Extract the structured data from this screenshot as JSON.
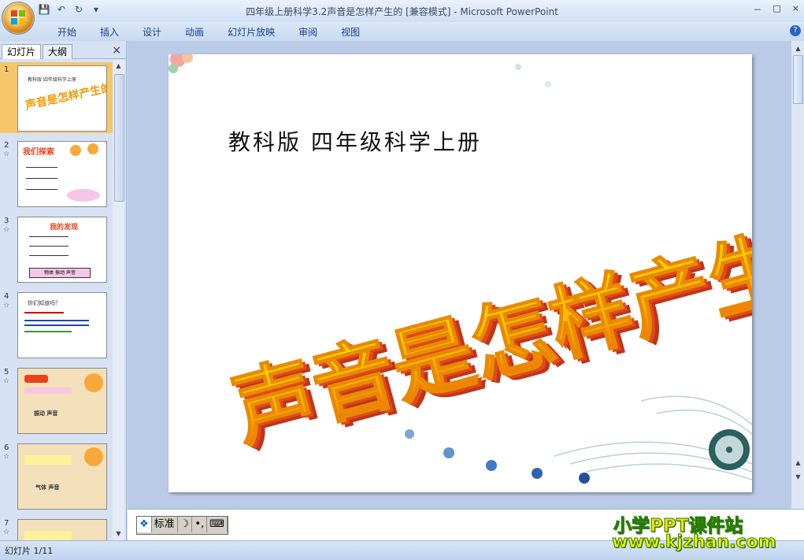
{
  "window": {
    "title": "四年级上册科学3.2声音是怎样产生的 [兼容模式] - Microsoft PowerPoint",
    "controls": [
      "－",
      "□",
      "×"
    ]
  },
  "qat": {
    "icons": [
      "save-icon",
      "undo-icon",
      "redo-icon",
      "customize-icon"
    ]
  },
  "ribbon": {
    "tabs": [
      "开始",
      "插入",
      "设计",
      "动画",
      "幻灯片放映",
      "审阅",
      "视图"
    ],
    "help": "?"
  },
  "panel": {
    "tab_slides": "幻灯片",
    "tab_outline": "大纲",
    "close": "×",
    "thumbnails": [
      {
        "num": "1",
        "selected": true,
        "star": false
      },
      {
        "num": "2",
        "selected": false,
        "star": true
      },
      {
        "num": "3",
        "selected": false,
        "star": true
      },
      {
        "num": "4",
        "selected": false,
        "star": true
      },
      {
        "num": "5",
        "selected": false,
        "star": true
      },
      {
        "num": "6",
        "selected": false,
        "star": true
      },
      {
        "num": "7",
        "selected": false,
        "star": true
      }
    ],
    "thumb_texts": {
      "t1_sub": "教科版 四年级科学上册",
      "t1_big": "声音是怎样产生的",
      "t2_title": "我们探索",
      "t3_title": "我的发现",
      "t3_box": "物体  振动  声音",
      "t4_title": "你们知道吗？",
      "t5_line": "振动    声音",
      "t6_line": "气体    声音"
    }
  },
  "slide": {
    "subtitle": "教科版 四年级科学上册",
    "main_title": "声音是怎样产生的"
  },
  "ime": {
    "items": [
      "标准",
      "☽",
      "•,",
      "⌨"
    ]
  },
  "status": {
    "text": "幻灯片 1/11"
  },
  "watermark": {
    "line1": "小学PPT课件站",
    "line2": "www.kjzhan.com"
  },
  "colors": {
    "title_top": "#ffd100",
    "title_bottom": "#e8421a",
    "title_side": "#c0341a",
    "accent": "#f6c66b"
  }
}
